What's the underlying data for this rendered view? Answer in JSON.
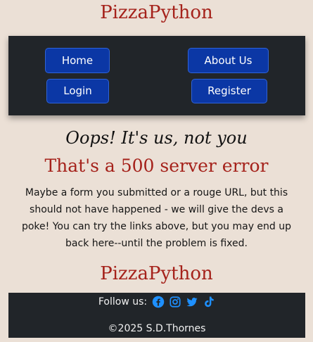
{
  "header": {
    "brand": "PizzaPython"
  },
  "nav": {
    "home": "Home",
    "about": "About Us",
    "login": "Login",
    "register": "Register"
  },
  "main": {
    "oops": "Oops! It's us, not you",
    "title": "That's a 500 server error",
    "message": "Maybe a form you submitted or a rouge URL, but this should not have happened - we will give the devs a poke! You can try the links above, but you may end up back here--until the problem is fixed."
  },
  "footer": {
    "brand": "PizzaPython",
    "follow_label": "Follow us:",
    "social_icons": [
      "facebook-icon",
      "instagram-icon",
      "twitter-icon",
      "tiktok-icon"
    ],
    "copyright": "©2025 S.D.Thornes"
  },
  "colors": {
    "background": "#ebe0d6",
    "brand_red": "#a5221b",
    "nav_bg": "#212529",
    "button_blue": "#0b37a5",
    "icon_blue": "#1e90ff"
  }
}
